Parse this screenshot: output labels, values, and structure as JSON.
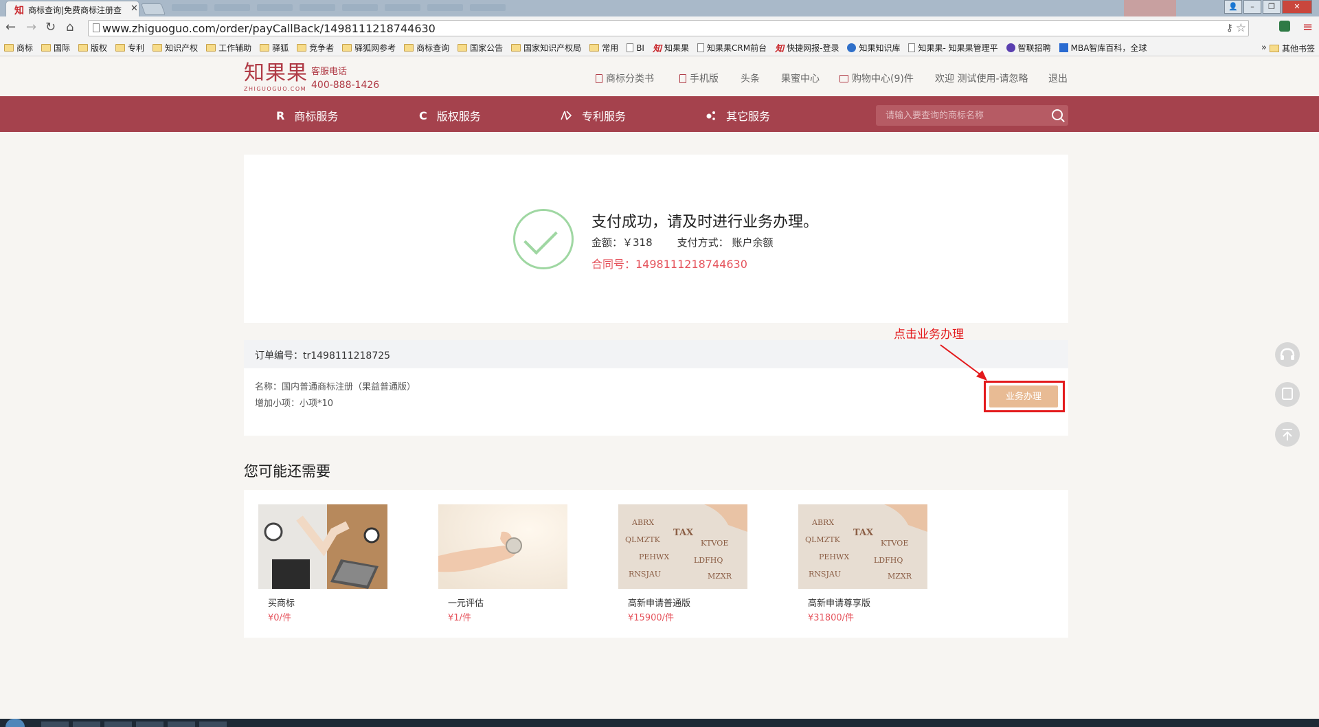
{
  "browser": {
    "tab_title": "商标查询|免费商标注册查",
    "tab_favicon": "知",
    "url": "www.zhiguoguo.com/order/payCallBack/1498111218744630",
    "bookmarks": [
      "商标",
      "国际",
      "版权",
      "专利",
      "知识产权",
      "工作辅助",
      "驿狐",
      "竞争者",
      "驿狐网参考",
      "商标查询",
      "国家公告",
      "国家知识产权局",
      "常用",
      "BI",
      "知果果",
      "知果果CRM前台",
      "快捷网报-登录",
      "知果知识库",
      "知果果- 知果果管理平",
      "智联招聘",
      "MBA智库百科，全球"
    ],
    "bookmarks_more": "»",
    "bookmarks_other": "其他书签"
  },
  "site": {
    "logo_cn": "知果果",
    "logo_en": "ZHIGUOGUO.COM",
    "hotline_label": "客服电话",
    "hotline_number": "400-888-1426",
    "top_links": {
      "trademark_book": "商标分类书",
      "mobile": "手机版",
      "headlines": "头条",
      "honey_center": "果蜜中心",
      "cart": "购物中心(9)件",
      "welcome": "欢迎 测试使用-请忽略",
      "logout": "退出"
    },
    "nav": {
      "trademark_icon": "R",
      "trademark": "商标服务",
      "copyright_icon": "C",
      "copyright": "版权服务",
      "patent": "专利服务",
      "other": "其它服务"
    },
    "search_placeholder": "请输入要查询的商标名称"
  },
  "payment": {
    "title": "支付成功，请及时进行业务办理。",
    "amount_label": "金额：",
    "amount_value": "￥318",
    "method_label": "支付方式：",
    "method_value": "账户余额",
    "contract": "合同号：1498111218744630"
  },
  "order": {
    "number": "订单编号：tr1498111218725",
    "name": "名称：国内普通商标注册（果益普通版）",
    "extra": "增加小项：小项*10",
    "action_label": "业务办理"
  },
  "annotation": {
    "text": "点击业务办理"
  },
  "recommend": {
    "title": "您可能还需要",
    "items": [
      {
        "name": "买商标",
        "price": "¥0/件",
        "image": "handshake-laptop"
      },
      {
        "name": "一元评估",
        "price": "¥1/件",
        "image": "hand-holding-coin"
      },
      {
        "name": "高新申请普通版",
        "price": "¥15900/件",
        "image": "tax-letters"
      },
      {
        "name": "高新申请尊享版",
        "price": "¥31800/件",
        "image": "tax-letters"
      }
    ]
  },
  "colors": {
    "brand": "#a5424d",
    "accent_red": "#e5535c",
    "success_green": "#9fd7a2",
    "button_orange": "#e8bb94",
    "annotation_red": "#e31a1c"
  }
}
